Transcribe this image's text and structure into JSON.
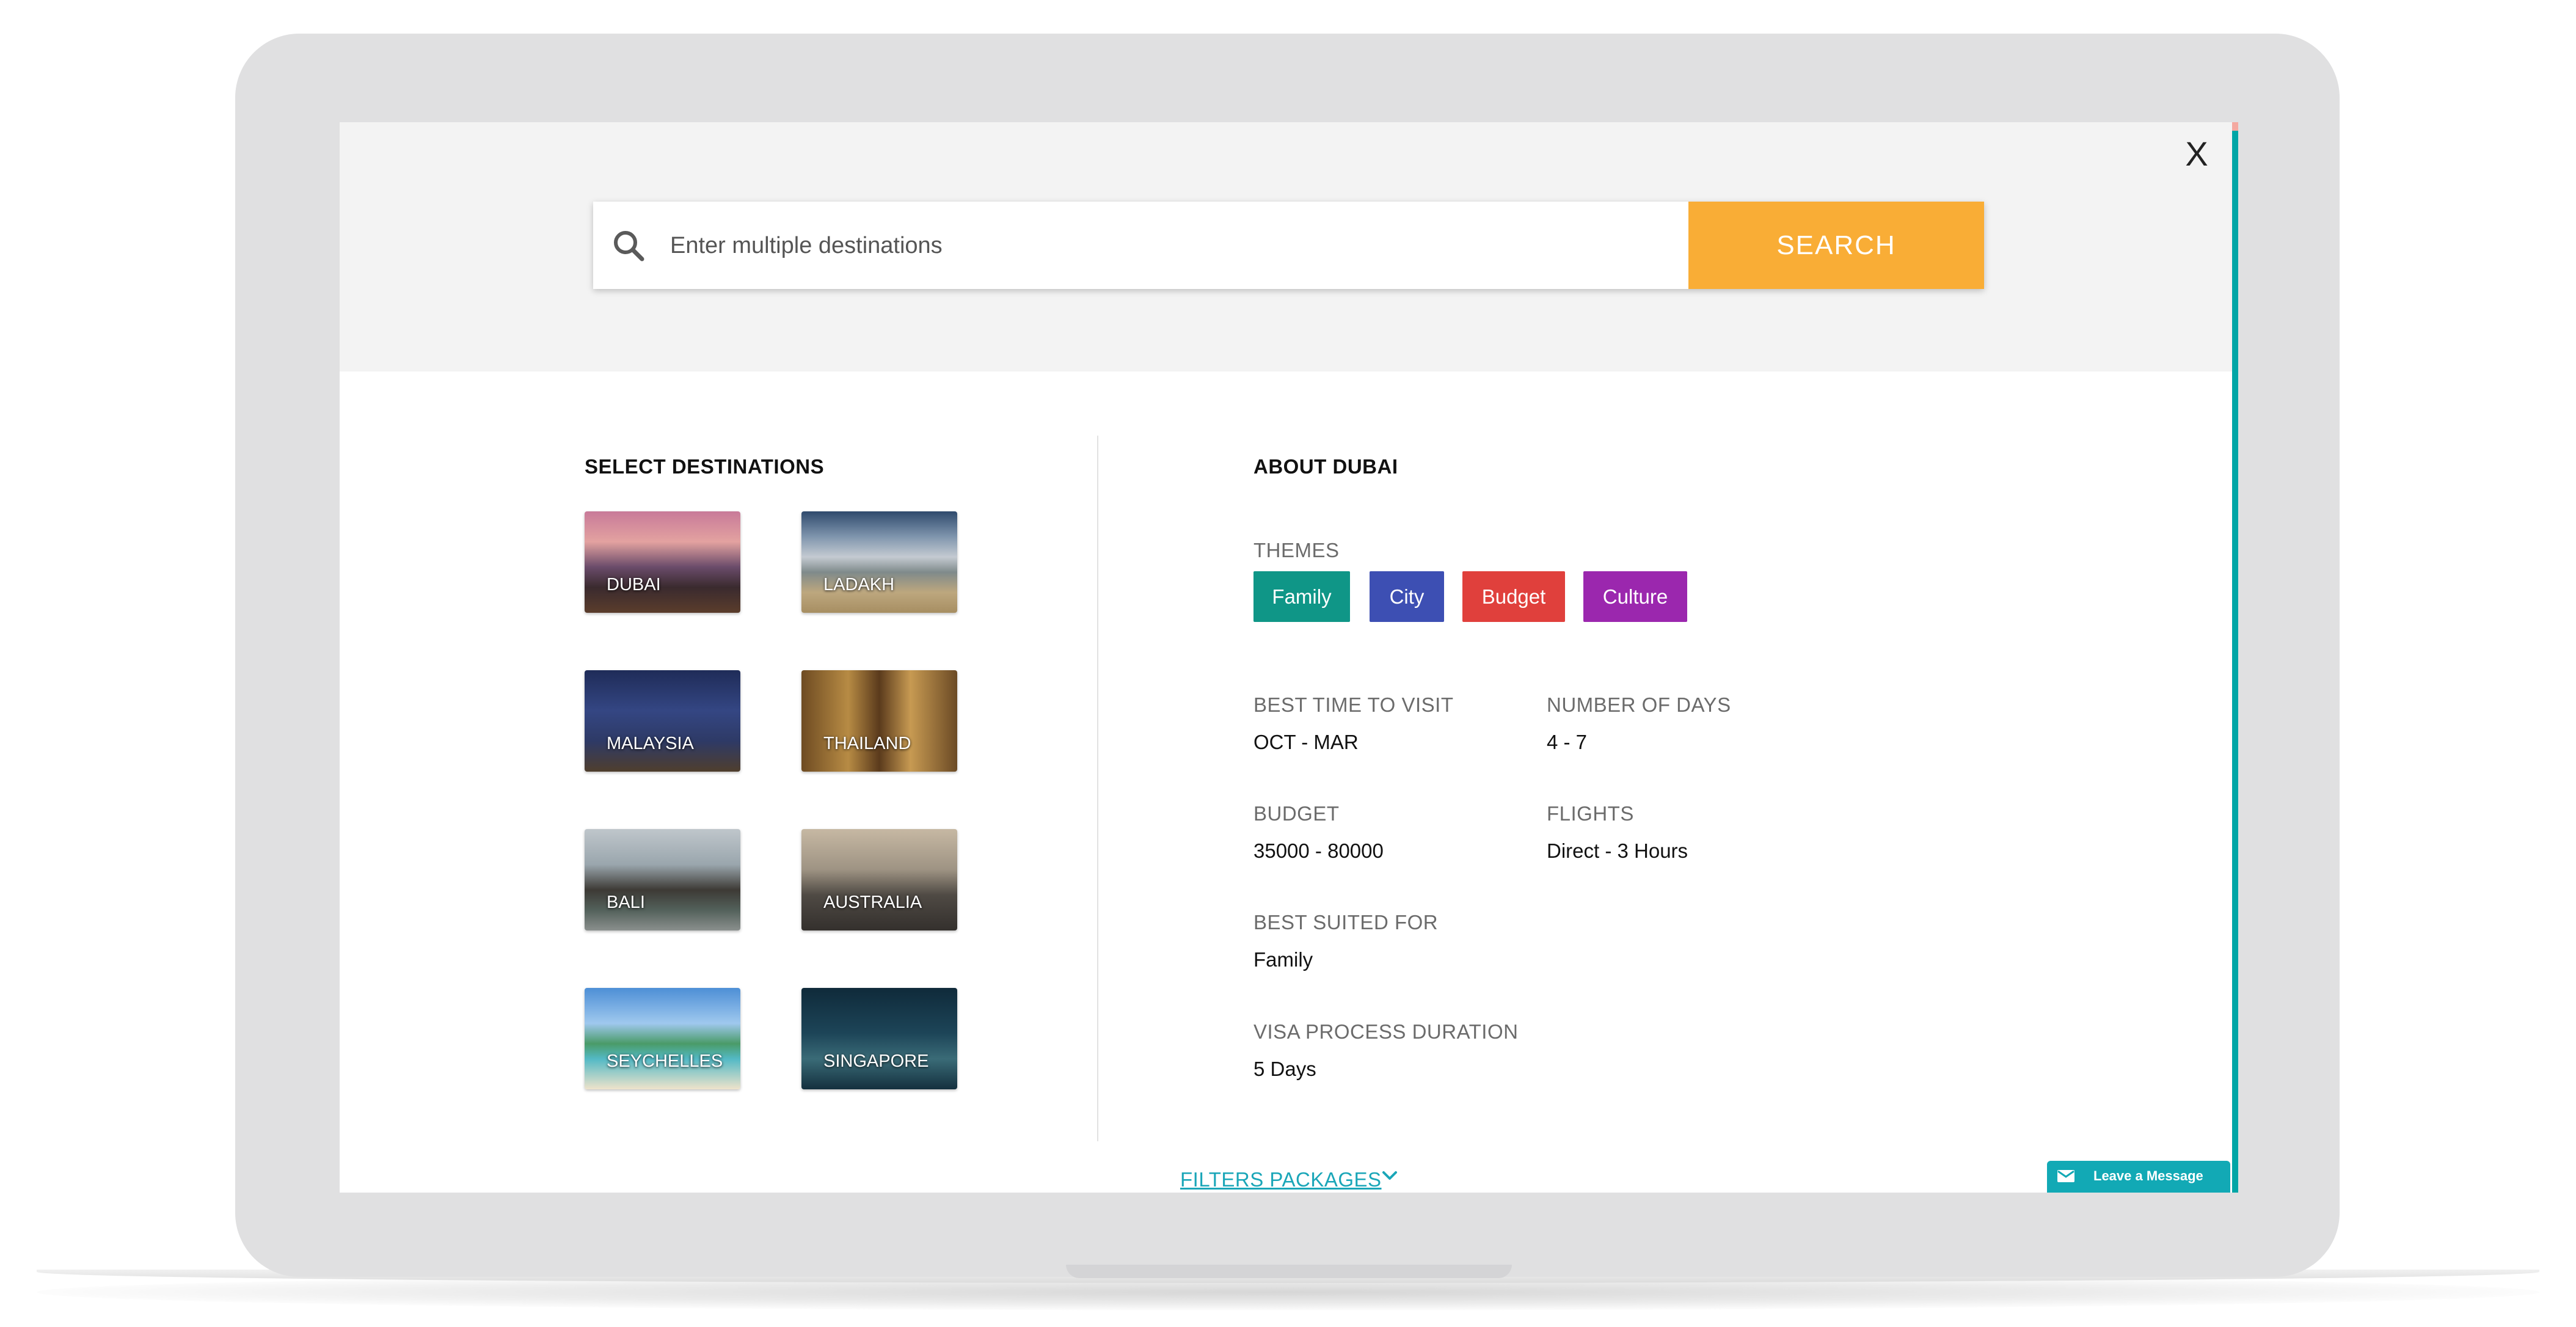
{
  "close_label": "X",
  "search": {
    "placeholder": "Enter multiple destinations",
    "button_label": "SEARCH",
    "icon": "search-icon"
  },
  "destinations": {
    "title": "SELECT DESTINATIONS",
    "items": [
      {
        "label": "DUBAI"
      },
      {
        "label": "LADAKH"
      },
      {
        "label": "MALAYSIA"
      },
      {
        "label": "THAILAND"
      },
      {
        "label": "BALI"
      },
      {
        "label": "AUSTRALIA"
      },
      {
        "label": "SEYCHELLES"
      },
      {
        "label": "SINGAPORE"
      }
    ]
  },
  "about": {
    "title": "ABOUT DUBAI",
    "themes_label": "THEMES",
    "themes": [
      {
        "label": "Family",
        "color": "#0f9687"
      },
      {
        "label": "City",
        "color": "#3d4fb3"
      },
      {
        "label": "Budget",
        "color": "#e0403c"
      },
      {
        "label": "Culture",
        "color": "#9b27ae"
      }
    ],
    "best_time_label": "BEST TIME TO VISIT",
    "best_time_value": "OCT - MAR",
    "num_days_label": "NUMBER OF DAYS",
    "num_days_value": "4 - 7",
    "budget_label": "BUDGET",
    "budget_value": "35000 - 80000",
    "flights_label": "FLIGHTS",
    "flights_value": "Direct - 3 Hours",
    "best_suited_label": "BEST SUITED FOR",
    "best_suited_value": "Family",
    "visa_label": "VISA PROCESS DURATION",
    "visa_value": "5 Days"
  },
  "filters_label": "FILTERS PACKAGES",
  "leave_message_label": "Leave a Message",
  "colors": {
    "accent": "#f9ad36",
    "teal": "#00a6a6",
    "link": "#1aa6b8"
  }
}
